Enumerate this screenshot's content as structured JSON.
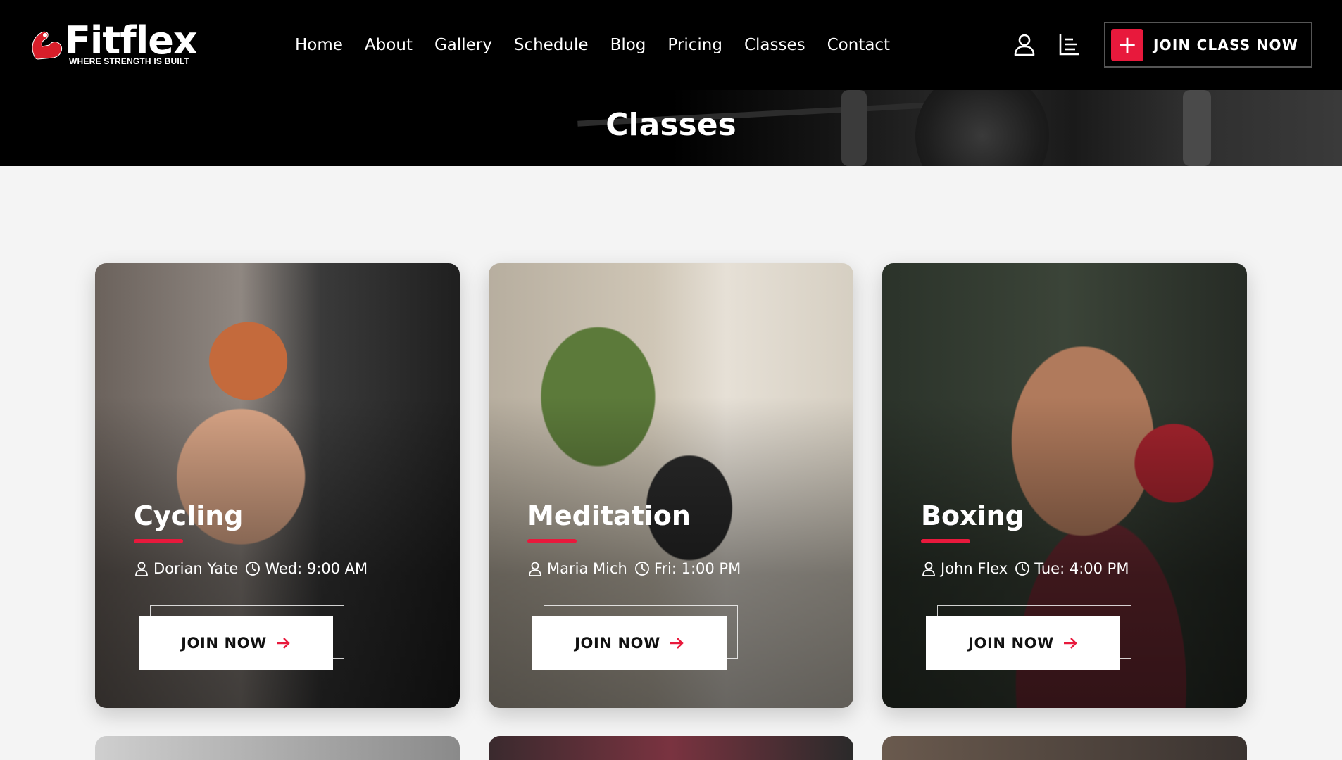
{
  "brand": {
    "name": "Fitflex",
    "tagline": "WHERE STRENGTH IS BUILT"
  },
  "nav": {
    "items": [
      {
        "label": "Home"
      },
      {
        "label": "About"
      },
      {
        "label": "Gallery"
      },
      {
        "label": "Schedule"
      },
      {
        "label": "Blog"
      },
      {
        "label": "Pricing"
      },
      {
        "label": "Classes"
      },
      {
        "label": "Contact"
      }
    ]
  },
  "header": {
    "join_class_label": "JOIN CLASS NOW",
    "join_class_icon": "plus-icon",
    "user_icon": "user-icon",
    "menu_icon": "menu-icon"
  },
  "banner": {
    "title": "Classes"
  },
  "colors": {
    "accent": "#e8193c",
    "header_bg": "#000000",
    "page_bg": "#f4f4f4"
  },
  "classes": [
    {
      "title": "Cycling",
      "trainer": "Dorian Yate",
      "time": "Wed: 9:00 AM",
      "button": "JOIN NOW"
    },
    {
      "title": "Meditation",
      "trainer": "Maria Mich",
      "time": "Fri: 1:00 PM",
      "button": "JOIN NOW"
    },
    {
      "title": "Boxing",
      "trainer": "John Flex",
      "time": "Tue: 4:00 PM",
      "button": "JOIN NOW"
    }
  ]
}
